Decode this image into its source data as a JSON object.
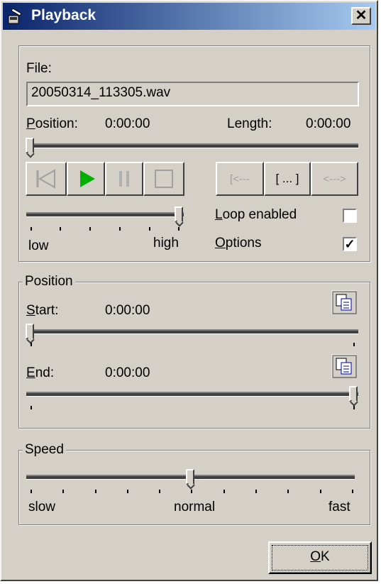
{
  "window": {
    "title": "Playback",
    "close_glyph": "✕"
  },
  "file": {
    "label": "File:",
    "value": "20050314_113305.wav"
  },
  "position_row": {
    "label_prefix": "P",
    "label_rest": "osition:",
    "value": "0:00:00",
    "length_label": "Length:",
    "length_value": "0:00:00",
    "progress": 0
  },
  "transport": {
    "skip_back": "skip-back-icon",
    "play": "play-icon",
    "pause": "pause-icon",
    "stop": "stop-icon",
    "mark_start": "[<---",
    "mark_range": "[ ... ]",
    "mark_end": "<--->"
  },
  "volume": {
    "low_label": "low",
    "high_label": "high",
    "level": 1.0
  },
  "loop": {
    "label_prefix": "L",
    "label_rest": "oop enabled",
    "checked": false
  },
  "options": {
    "label_prefix": "O",
    "label_rest": "ptions",
    "checked": true,
    "check_glyph": "✓"
  },
  "position_group": {
    "legend": "Position",
    "start_prefix": "S",
    "start_rest": "tart:",
    "start_value": "0:00:00",
    "start_level": 0,
    "end_prefix": "E",
    "end_rest": "nd:",
    "end_value": "0:00:00",
    "end_level": 1
  },
  "speed_group": {
    "legend": "Speed",
    "slow": "slow",
    "normal": "normal",
    "fast": "fast",
    "level": 0.5
  },
  "ok": {
    "prefix": "O",
    "rest": "K"
  },
  "colors": {
    "face": "#d4d0c8",
    "title_start": "#0a246a",
    "title_end": "#a6caf0",
    "play_green": "#00b000"
  }
}
